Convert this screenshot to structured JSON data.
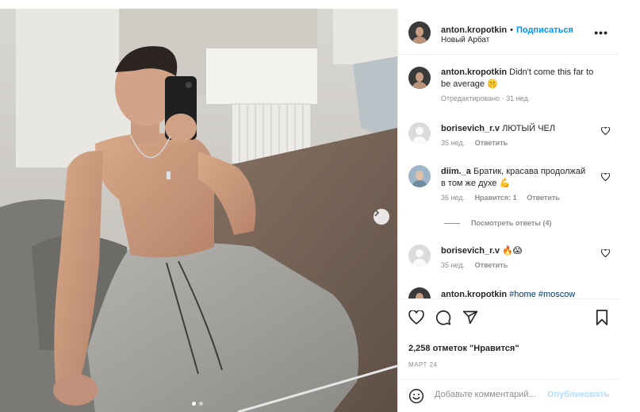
{
  "post": {
    "author": "anton.kropotkin",
    "follow_label": "Подписаться",
    "separator": "•",
    "location": "Новый Арбат",
    "more_label": "•••",
    "media": {
      "slide_count": 2,
      "active_slide": 1
    }
  },
  "caption": {
    "author": "anton.kropotkin",
    "text": "Didn't come this far to be average 🤫",
    "edited": "Отредактировано",
    "time": "31 нед."
  },
  "comments": [
    {
      "author": "borisevich_r.v",
      "text": "ЛЮТЫЙ ЧЕЛ",
      "time": "35 нед.",
      "likes": "",
      "reply_label": "Ответить"
    },
    {
      "author": "diim._a",
      "text": "Братик, красава продолжай в том же духе 💪",
      "time": "36 нед.",
      "likes": "Нравится: 1",
      "reply_label": "Ответить"
    },
    {
      "author": "borisevich_r.v",
      "text": "🔥😱",
      "time": "35 нед.",
      "likes": "",
      "reply_label": "Ответить"
    }
  ],
  "view_replies": "Посмотреть ответы (4)",
  "partial_comment": {
    "author": "anton.kropotkin",
    "text": "#home #moscow"
  },
  "stats": {
    "likes_text": "2,258 отметок \"Нравится\"",
    "date": "МАРТ 24"
  },
  "composer": {
    "placeholder": "Добавьте комментарий...",
    "publish_label": "Опубликовать"
  },
  "colors": {
    "link": "#0095f6",
    "publish_disabled": "#b2dffc",
    "meta": "#8e8e8e"
  }
}
